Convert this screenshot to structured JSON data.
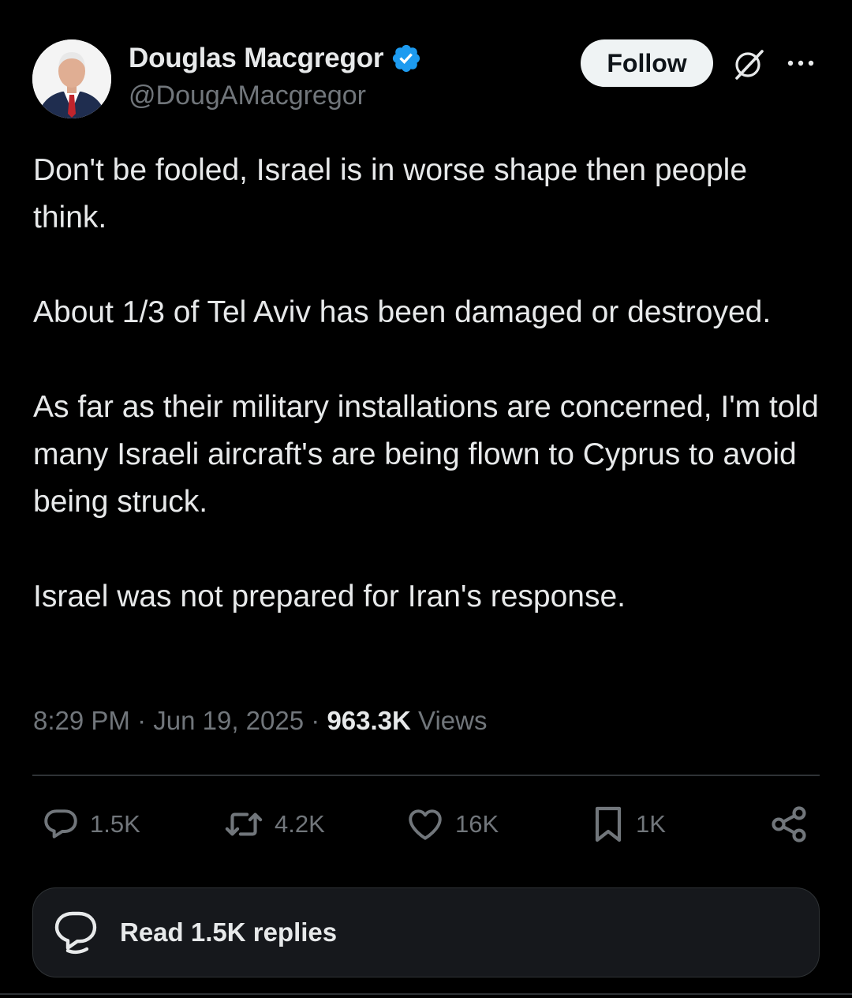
{
  "author": {
    "name": "Douglas Macgregor",
    "handle": "@DougAMacgregor",
    "verified": true,
    "badge_color": "#1d9bf0"
  },
  "header": {
    "follow_label": "Follow",
    "grok_icon": "grok-icon",
    "more_icon": "more-dots-icon"
  },
  "post": {
    "paragraphs": [
      "Don't be fooled, Israel is in worse shape then people think.",
      "About 1/3 of Tel Aviv has been damaged or destroyed.",
      "As far as their military installations are concerned, I'm told many Israeli aircraft's are being flown to Cyprus to avoid being struck.",
      "Israel was not prepared for Iran's response."
    ],
    "time": "8:29 PM",
    "date": "Jun 19, 2025",
    "views_count": "963.3K",
    "views_label": "Views"
  },
  "actions": {
    "replies": "1.5K",
    "reposts": "4.2K",
    "likes": "16K",
    "bookmarks": "1K"
  },
  "read_replies": {
    "label": "Read 1.5K replies"
  },
  "colors": {
    "background": "#000000",
    "text": "#e7e9ea",
    "muted": "#71767b",
    "divider": "#2f3336",
    "accent": "#1d9bf0"
  }
}
